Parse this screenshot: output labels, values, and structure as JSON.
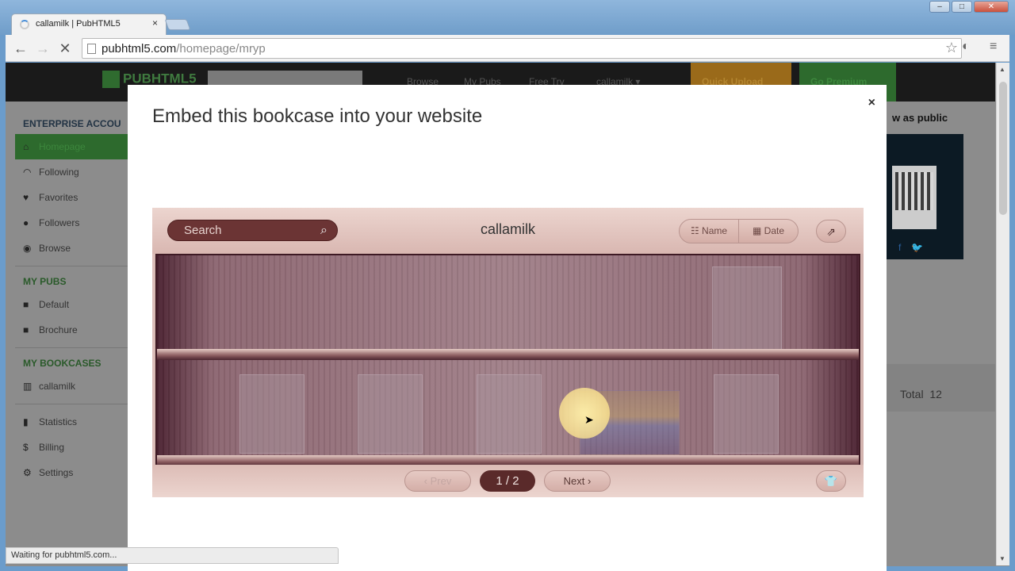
{
  "browser": {
    "tab_title": "callamilk | PubHTML5",
    "tab_close": "×",
    "url_host": "pubhtml5.com",
    "url_path": "/homepage/mryp",
    "status": "Waiting for pubhtml5.com..."
  },
  "site": {
    "logo": "PUBHTML5",
    "nav": [
      "Browse",
      "My Pubs",
      "Free Try"
    ],
    "user": "callamilk ▾",
    "quick_upload": "Quick Upload",
    "go_premium": "Go Premium"
  },
  "sidebar": {
    "account_heading": "ENTERPRISE ACCOU",
    "account_items": [
      {
        "label": "Homepage",
        "icon": "home-icon"
      },
      {
        "label": "Following",
        "icon": "rss-icon"
      },
      {
        "label": "Favorites",
        "icon": "heart-icon"
      },
      {
        "label": "Followers",
        "icon": "users-icon"
      },
      {
        "label": "Browse",
        "icon": "eye-icon"
      }
    ],
    "pubs_heading": "MY PUBS",
    "pubs_items": [
      "Default",
      "Brochure"
    ],
    "bookcases_heading": "MY BOOKCASES",
    "bookcases_items": [
      "callamilk"
    ],
    "other_items": [
      "Statistics",
      "Billing",
      "Settings"
    ]
  },
  "right_panel": {
    "title": "w as public",
    "total_label": "Total",
    "total_value": "12"
  },
  "modal": {
    "title": "Embed this bookcase into your website",
    "close": "×"
  },
  "bookcase": {
    "search_placeholder": "Search",
    "title": "callamilk",
    "sort_name": "Name",
    "sort_date": "Date",
    "prev": "Prev",
    "next": "Next",
    "page": "1 / 2"
  }
}
